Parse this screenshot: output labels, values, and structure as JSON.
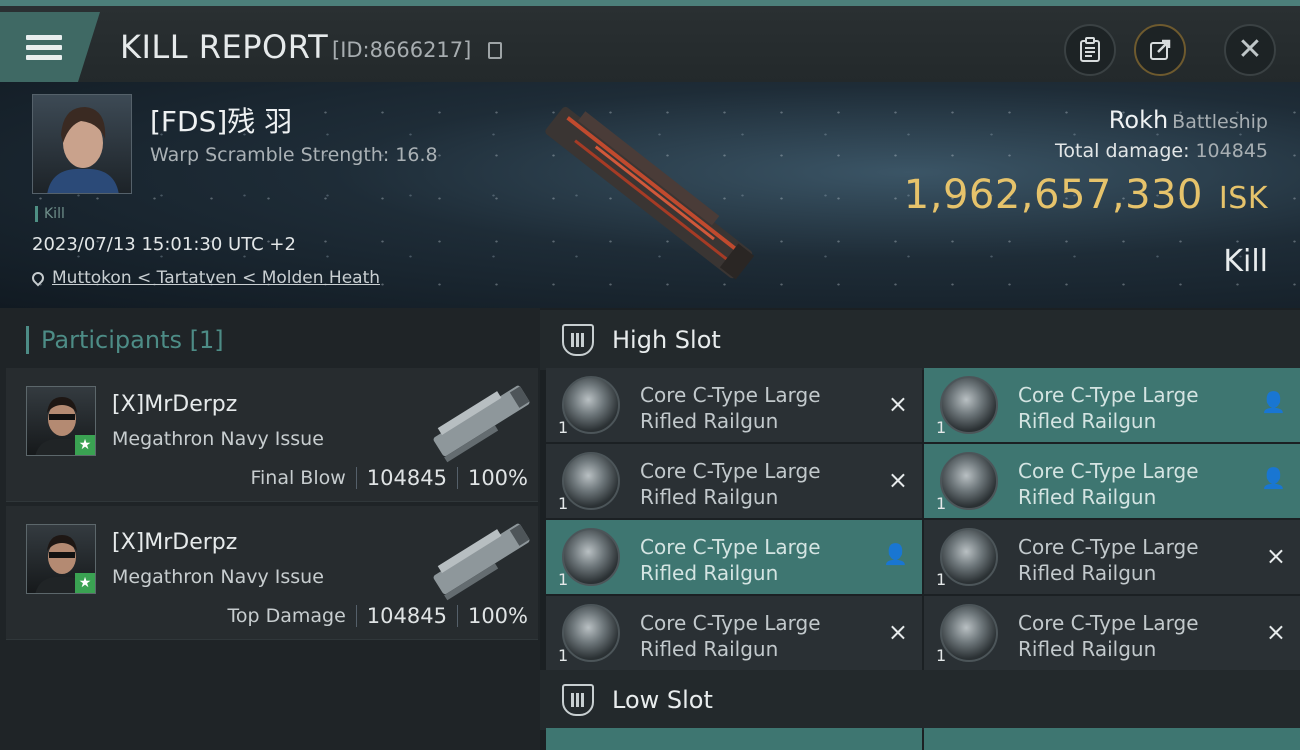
{
  "header": {
    "title": "KILL REPORT",
    "report_id": "[ID:8666217]",
    "actions": [
      "clipboard-icon",
      "export-icon",
      "close-icon"
    ]
  },
  "victim": {
    "name": "[FDS]残 羽",
    "warp_scramble": "Warp Scramble Strength: 16.8",
    "kill_tag": "Kill",
    "datetime": "2023/07/13 15:01:30 UTC +2",
    "location": "Muttokon < Tartatven < Molden Heath",
    "ship_name": "Rokh",
    "ship_class": "Battleship",
    "total_damage_label": "Total damage:",
    "total_damage": "104845",
    "isk_value": "1,962,657,330",
    "isk_unit": "ISK",
    "result": "Kill"
  },
  "participants": {
    "header": "Participants [1]",
    "items": [
      {
        "name": "[X]MrDerpz",
        "ship": "Megathron Navy Issue",
        "role": "Final Blow",
        "damage": "104845",
        "percent": "100%"
      },
      {
        "name": "[X]MrDerpz",
        "ship": "Megathron Navy Issue",
        "role": "Top Damage",
        "damage": "104845",
        "percent": "100%"
      }
    ]
  },
  "slots": {
    "high": {
      "label": "High Slot",
      "modules": [
        {
          "name": "Core C-Type Large Rifled Railgun",
          "qty": "1",
          "status": "destroyed",
          "status_icon": "×",
          "active": false
        },
        {
          "name": "Core C-Type Large Rifled Railgun",
          "qty": "1",
          "status": "dropped",
          "status_icon": "👤",
          "active": true
        },
        {
          "name": "Core C-Type Large Rifled Railgun",
          "qty": "1",
          "status": "destroyed",
          "status_icon": "×",
          "active": false
        },
        {
          "name": "Core C-Type Large Rifled Railgun",
          "qty": "1",
          "status": "dropped",
          "status_icon": "👤",
          "active": true
        },
        {
          "name": "Core C-Type Large Rifled Railgun",
          "qty": "1",
          "status": "dropped",
          "status_icon": "👤",
          "active": true
        },
        {
          "name": "Core C-Type Large Rifled Railgun",
          "qty": "1",
          "status": "destroyed",
          "status_icon": "×",
          "active": false
        },
        {
          "name": "Core C-Type Large Rifled Railgun",
          "qty": "1",
          "status": "destroyed",
          "status_icon": "×",
          "active": false
        },
        {
          "name": "Core C-Type Large Rifled Railgun",
          "qty": "1",
          "status": "destroyed",
          "status_icon": "×",
          "active": false
        }
      ]
    },
    "low": {
      "label": "Low Slot"
    }
  },
  "colors": {
    "accent": "#3e7671",
    "isk": "#e6c36b",
    "badge": "#3aa252"
  }
}
